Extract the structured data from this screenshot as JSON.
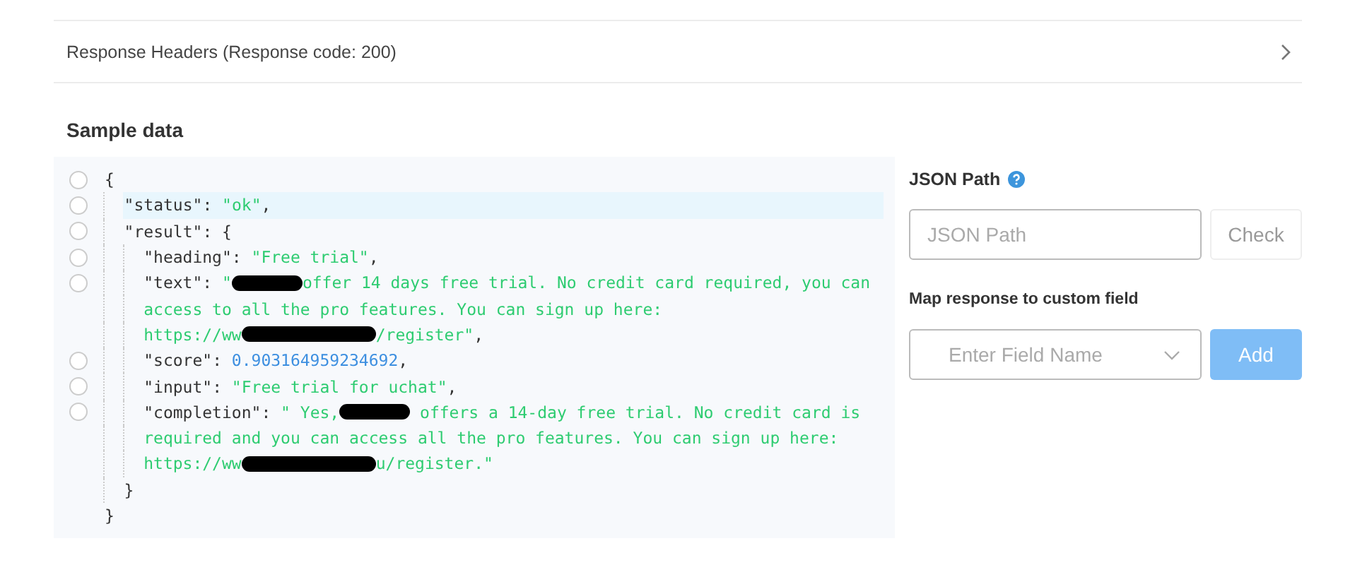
{
  "response_headers": {
    "label": "Response Headers (Response code: 200)",
    "expanded": false
  },
  "sample_data": {
    "title": "Sample data",
    "code": [
      {
        "kind": "option",
        "selected": false,
        "highlighted": false,
        "parts": [
          {
            "kind": "punct",
            "text": "{"
          }
        ],
        "children": [
          {
            "kind": "option",
            "selected": false,
            "highlighted": true,
            "parts": [
              {
                "kind": "key",
                "text": "\"status\""
              },
              {
                "kind": "punct",
                "text": ": "
              },
              {
                "kind": "string",
                "text": "\"ok\""
              },
              {
                "kind": "punct",
                "text": ","
              }
            ]
          },
          {
            "kind": "option",
            "selected": false,
            "highlighted": false,
            "parts": [
              {
                "kind": "key",
                "text": "\"result\""
              },
              {
                "kind": "punct",
                "text": ": {"
              }
            ],
            "children": [
              {
                "kind": "option",
                "selected": false,
                "highlighted": false,
                "parts": [
                  {
                    "kind": "key",
                    "text": "\"heading\""
                  },
                  {
                    "kind": "punct",
                    "text": ": "
                  },
                  {
                    "kind": "string",
                    "text": "\"Free trial\""
                  },
                  {
                    "kind": "punct",
                    "text": ","
                  }
                ]
              },
              {
                "kind": "option",
                "selected": false,
                "highlighted": false,
                "parts": [
                  {
                    "kind": "key",
                    "text": "\"text\""
                  },
                  {
                    "kind": "punct",
                    "text": ": "
                  },
                  {
                    "kind": "string",
                    "text": "\""
                  },
                  {
                    "kind": "mask"
                  },
                  {
                    "kind": "string",
                    "text": "offer 14 days free trial. No credit card required, you can"
                  }
                ]
              },
              {
                "kind": "continuation",
                "highlighted": false,
                "parts": [
                  {
                    "kind": "string",
                    "text": "access to all the pro features. You can sign up here:"
                  }
                ]
              },
              {
                "kind": "continuation",
                "highlighted": false,
                "parts": [
                  {
                    "kind": "string",
                    "text": "https://ww"
                  },
                  {
                    "kind": "longmask"
                  },
                  {
                    "kind": "string",
                    "text": "/register\""
                  },
                  {
                    "kind": "punct",
                    "text": ","
                  }
                ]
              },
              {
                "kind": "option",
                "selected": false,
                "highlighted": false,
                "parts": [
                  {
                    "kind": "key",
                    "text": "\"score\""
                  },
                  {
                    "kind": "punct",
                    "text": ": "
                  },
                  {
                    "kind": "number",
                    "text": "0.903164959234692"
                  },
                  {
                    "kind": "punct",
                    "text": ","
                  }
                ]
              },
              {
                "kind": "option",
                "selected": false,
                "highlighted": false,
                "parts": [
                  {
                    "kind": "key",
                    "text": "\"input\""
                  },
                  {
                    "kind": "punct",
                    "text": ": "
                  },
                  {
                    "kind": "string",
                    "text": "\"Free trial for uchat\""
                  },
                  {
                    "kind": "punct",
                    "text": ","
                  }
                ]
              },
              {
                "kind": "option",
                "selected": false,
                "highlighted": false,
                "parts": [
                  {
                    "kind": "key",
                    "text": "\"completion\""
                  },
                  {
                    "kind": "punct",
                    "text": ": "
                  },
                  {
                    "kind": "string",
                    "text": "\" Yes,"
                  },
                  {
                    "kind": "mask"
                  },
                  {
                    "kind": "string",
                    "text": " offers a 14-day free trial. No credit card is"
                  }
                ]
              },
              {
                "kind": "continuation",
                "highlighted": false,
                "parts": [
                  {
                    "kind": "string",
                    "text": "required and you can access all the pro features. You can sign up here:"
                  }
                ]
              },
              {
                "kind": "continuation",
                "highlighted": false,
                "parts": [
                  {
                    "kind": "string",
                    "text": "https://ww"
                  },
                  {
                    "kind": "longmask"
                  },
                  {
                    "kind": "string",
                    "text": "u/register.\""
                  }
                ]
              }
            ]
          },
          {
            "kind": "continuation",
            "highlighted": false,
            "parts": [
              {
                "kind": "punct",
                "text": "}"
              }
            ]
          }
        ]
      },
      {
        "kind": "continuation",
        "highlighted": false,
        "parts": [
          {
            "kind": "punct",
            "text": "}"
          }
        ]
      }
    ]
  },
  "json_path": {
    "label": "JSON Path",
    "placeholder": "JSON Path",
    "button": "Check"
  },
  "mapping": {
    "label": "Map response to custom field",
    "placeholder": "Enter Field Name",
    "button": "Add"
  }
}
